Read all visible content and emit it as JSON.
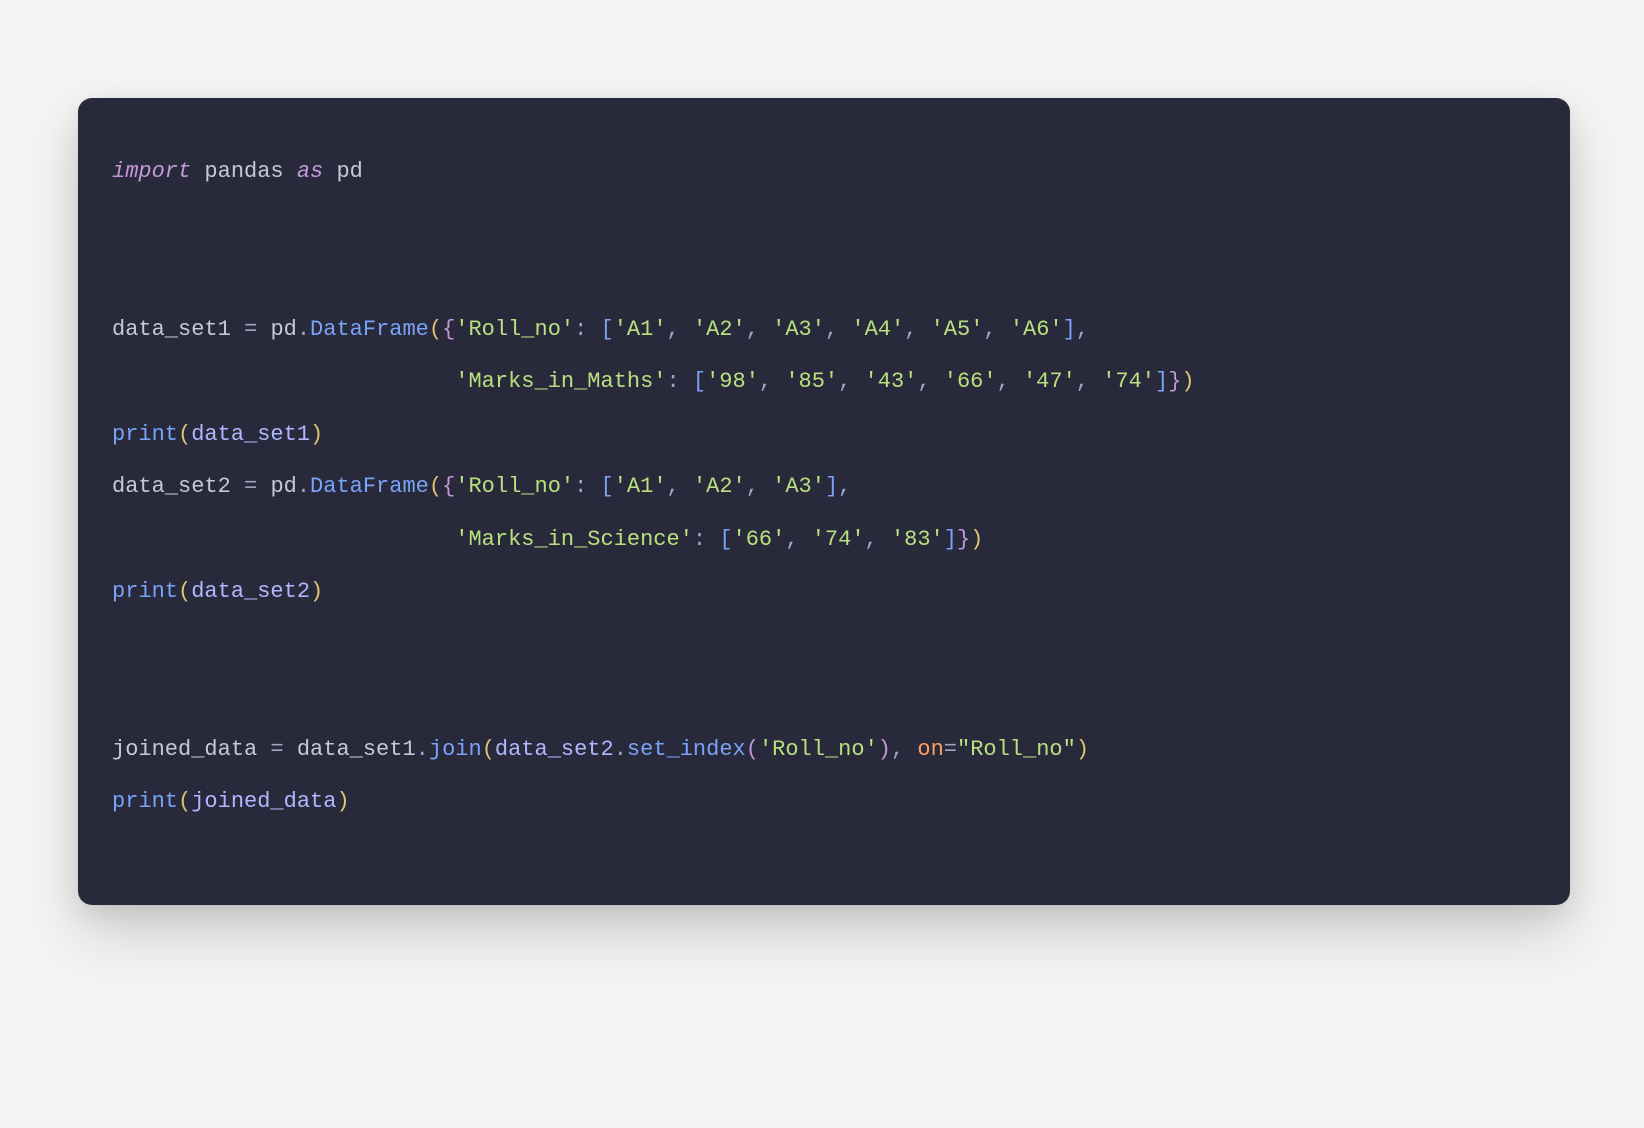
{
  "code": {
    "line1": {
      "import": "import",
      "pandas": "pandas",
      "as": "as",
      "pd": "pd"
    },
    "blank2": "",
    "blank3": "",
    "line4": {
      "data_set1": "data_set1",
      "eq": " = ",
      "pd": "pd",
      "dot": ".",
      "DataFrame": "DataFrame",
      "lpar": "(",
      "lbrc": "{",
      "roll_no": "'Roll_no'",
      "colon": ": ",
      "lbrk": "[",
      "items": [
        "'A1'",
        "'A2'",
        "'A3'",
        "'A4'",
        "'A5'",
        "'A6'"
      ],
      "rbrk": "]",
      "comma": ","
    },
    "line5": {
      "indent": "                          ",
      "marks": "'Marks_in_Maths'",
      "colon": ": ",
      "lbrk": "[",
      "items": [
        "'98'",
        "'85'",
        "'43'",
        "'66'",
        "'47'",
        "'74'"
      ],
      "rbrk": "]",
      "rbrc": "}",
      "rpar": ")"
    },
    "line6": {
      "print": "print",
      "lpar": "(",
      "data_set1": "data_set1",
      "rpar": ")"
    },
    "line7": {
      "data_set2": "data_set2",
      "eq": " = ",
      "pd": "pd",
      "dot": ".",
      "DataFrame": "DataFrame",
      "lpar": "(",
      "lbrc": "{",
      "roll_no": "'Roll_no'",
      "colon": ": ",
      "lbrk": "[",
      "items": [
        "'A1'",
        "'A2'",
        "'A3'"
      ],
      "rbrk": "]",
      "comma": ","
    },
    "line8": {
      "indent": "                          ",
      "marks": "'Marks_in_Science'",
      "colon": ": ",
      "lbrk": "[",
      "items": [
        "'66'",
        "'74'",
        "'83'"
      ],
      "rbrk": "]",
      "rbrc": "}",
      "rpar": ")"
    },
    "line9": {
      "print": "print",
      "lpar": "(",
      "data_set2": "data_set2",
      "rpar": ")"
    },
    "blank10": "",
    "blank11": "",
    "line12": {
      "joined_data": "joined_data",
      "eq": " = ",
      "data_set1": "data_set1",
      "dot1": ".",
      "join": "join",
      "lpar1": "(",
      "data_set2": "data_set2",
      "dot2": ".",
      "set_index": "set_index",
      "lpar2": "(",
      "roll_str": "'Roll_no'",
      "rpar2": ")",
      "comma": ", ",
      "on_kw": "on",
      "eq2": "=",
      "on_str": "\"Roll_no\"",
      "rpar1": ")"
    },
    "line13": {
      "print": "print",
      "lpar": "(",
      "joined_data": "joined_data",
      "rpar": ")"
    }
  }
}
